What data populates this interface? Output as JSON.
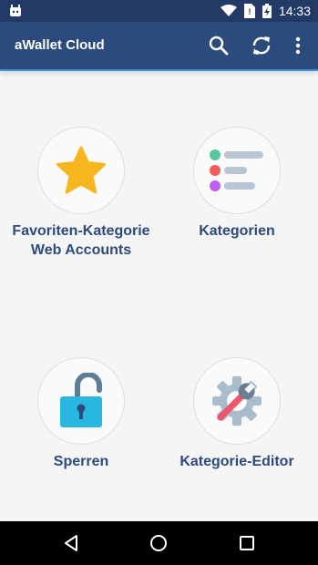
{
  "status_bar": {
    "time": "14:33",
    "icons": [
      "android-debug-icon",
      "wifi-icon",
      "no-sim-icon",
      "battery-charging-icon"
    ]
  },
  "app_bar": {
    "title": "aWallet Cloud",
    "actions": [
      "search-icon",
      "sync-icon",
      "overflow-menu-icon"
    ],
    "color": "#2d4a7d",
    "accent": "#3f96d6"
  },
  "tiles": [
    {
      "label_line1": "Favoriten-Kategorie",
      "label_line2": "Web Accounts",
      "icon": "star-icon"
    },
    {
      "label": "Kategorien",
      "icon": "category-list-icon"
    },
    {
      "label": "Sperren",
      "icon": "unlocked-padlock-icon"
    },
    {
      "label": "Kategorie-Editor",
      "icon": "settings-wrench-icon"
    }
  ],
  "nav_bar": {
    "buttons": [
      "back-icon",
      "home-icon",
      "recents-icon"
    ]
  }
}
